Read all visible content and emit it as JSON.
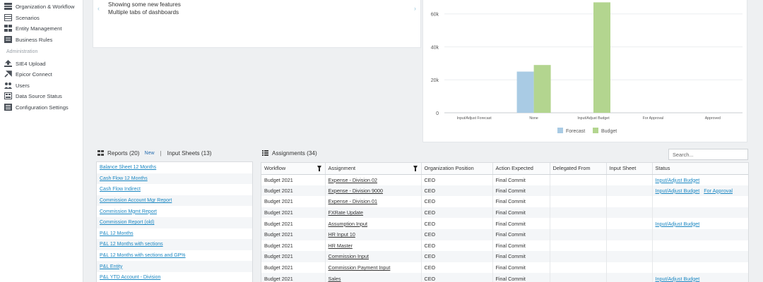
{
  "sidebar": {
    "items": [
      {
        "label": "Organization & Workflow",
        "icon": "organization-icon"
      },
      {
        "label": "Scenarios",
        "icon": "scenarios-icon"
      },
      {
        "label": "Entity Management",
        "icon": "entity-icon"
      },
      {
        "label": "Business Rules",
        "icon": "rules-icon"
      }
    ],
    "admin_section": "Administration",
    "admin_items": [
      {
        "label": "SIE4 Upload",
        "icon": "upload-icon"
      },
      {
        "label": "Epicor Connect",
        "icon": "connect-icon"
      },
      {
        "label": "Users",
        "icon": "users-icon"
      },
      {
        "label": "Data Source Status",
        "icon": "data-source-icon"
      },
      {
        "label": "Configuration Settings",
        "icon": "settings-icon"
      }
    ]
  },
  "news": {
    "lines": [
      "Showing some new features",
      "Multiple tabs of dashboards"
    ]
  },
  "chart_data": {
    "type": "bar",
    "categories": [
      "Input/Adjust Forecast",
      "None",
      "Input/Adjust Budget",
      "For Approval",
      "Approved"
    ],
    "series": [
      {
        "name": "Forecast",
        "color": "#a9cbe4",
        "values": [
          0,
          25000,
          0,
          0,
          0
        ]
      },
      {
        "name": "Budget",
        "color": "#b3d58f",
        "values": [
          0,
          29000,
          67000,
          0,
          0
        ]
      }
    ],
    "yticks": [
      "0",
      "20k",
      "40k",
      "60k"
    ],
    "ylim": [
      0,
      68000
    ],
    "grid": true,
    "legend_placement": "bottom"
  },
  "reports": {
    "title": "Reports (20)",
    "new_label": "New",
    "separator": "|",
    "input_sheets": "Input Sheets (13)",
    "items": [
      "Balance Sheet 12 Months",
      "Cash Flow 12 Months",
      "Cash Flow Indirect",
      "Commission Account Mgr Report",
      "Commission Mgmt Report",
      "Commission Report (old)",
      "P&L 12 Months",
      "P&L 12 Months with sections",
      "P&L 12 Months with sections and GP%",
      "P&L Entity",
      "P&L YTD Account - Division"
    ]
  },
  "assignments": {
    "title": "Assignments (34)",
    "search_placeholder": "Search...",
    "columns": [
      "Workflow",
      "Assignment",
      "Organization Position",
      "Action Expected",
      "Delegated From",
      "Input Sheet",
      "Status"
    ],
    "rows": [
      {
        "workflow": "Budget 2021",
        "assignment": "Expense - Division 02",
        "position": "CEO",
        "action": "Final Commit",
        "delegated": "",
        "sheet": "",
        "status": "Input/Adjust Budget",
        "status2": ""
      },
      {
        "workflow": "Budget 2021",
        "assignment": "Expense - Division 9000",
        "position": "CEO",
        "action": "Final Commit",
        "delegated": "",
        "sheet": "",
        "status": "Input/Adjust Budget",
        "status2": "For Approval"
      },
      {
        "workflow": "Budget 2021",
        "assignment": "Expense - Division 01",
        "position": "CEO",
        "action": "Final Commit",
        "delegated": "",
        "sheet": "",
        "status": "",
        "status2": ""
      },
      {
        "workflow": "Budget 2021",
        "assignment": "FXRate Update",
        "position": "CEO",
        "action": "Final Commit",
        "delegated": "",
        "sheet": "",
        "status": "",
        "status2": ""
      },
      {
        "workflow": "Budget 2021",
        "assignment": "Assumption Input",
        "position": "CEO",
        "action": "Final Commit",
        "delegated": "",
        "sheet": "",
        "status": "Input/Adjust Budget",
        "status2": ""
      },
      {
        "workflow": "Budget 2021",
        "assignment": "HR Input 10",
        "position": "CEO",
        "action": "Final Commit",
        "delegated": "",
        "sheet": "",
        "status": "",
        "status2": ""
      },
      {
        "workflow": "Budget 2021",
        "assignment": "HR Master",
        "position": "CEO",
        "action": "Final Commit",
        "delegated": "",
        "sheet": "",
        "status": "",
        "status2": ""
      },
      {
        "workflow": "Budget 2021",
        "assignment": "Commission Input",
        "position": "CEO",
        "action": "Final Commit",
        "delegated": "",
        "sheet": "",
        "status": "",
        "status2": ""
      },
      {
        "workflow": "Budget 2021",
        "assignment": "Commission Payment Input",
        "position": "CEO",
        "action": "Final Commit",
        "delegated": "",
        "sheet": "",
        "status": "",
        "status2": ""
      },
      {
        "workflow": "Budget 2021",
        "assignment": "Sales",
        "position": "CEO",
        "action": "Final Commit",
        "delegated": "",
        "sheet": "",
        "status": "Input/Adjust Budget",
        "status2": ""
      }
    ]
  }
}
